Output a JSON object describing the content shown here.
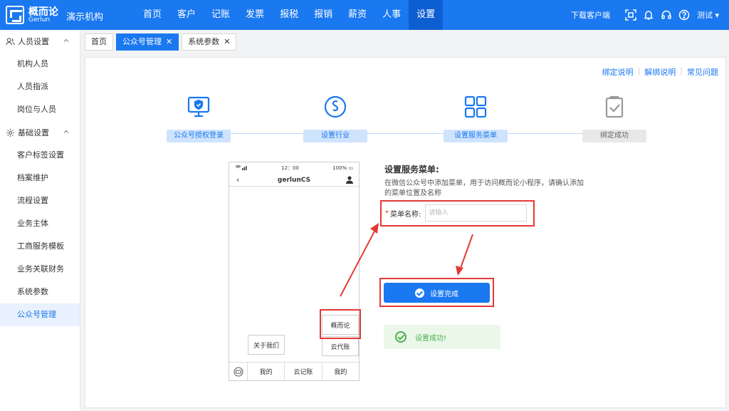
{
  "brand": {
    "name_cn": "概而论",
    "name_en": "Gerlun",
    "org": "演示机构"
  },
  "nav": [
    {
      "label": "首页",
      "active": false
    },
    {
      "label": "客户",
      "active": false
    },
    {
      "label": "记账",
      "active": false
    },
    {
      "label": "发票",
      "active": false
    },
    {
      "label": "报税",
      "active": false
    },
    {
      "label": "报销",
      "active": false
    },
    {
      "label": "薪资",
      "active": false
    },
    {
      "label": "人事",
      "active": false
    },
    {
      "label": "设置",
      "active": true
    }
  ],
  "topright": {
    "download": "下载客户端",
    "user": "测试 ▾"
  },
  "sidebar": {
    "group1": {
      "label": "人员设置",
      "items": [
        "机构人员",
        "人员指派",
        "岗位与人员"
      ]
    },
    "group2": {
      "label": "基础设置",
      "items": [
        "客户标签设置",
        "档案维护",
        "流程设置",
        "业务主体",
        "工商服务模板",
        "业务关联财务",
        "系统参数",
        "公众号管理"
      ]
    },
    "active_item": "公众号管理"
  },
  "tabs": [
    {
      "label": "首页",
      "closable": false,
      "active": false
    },
    {
      "label": "公众号管理",
      "closable": true,
      "active": true
    },
    {
      "label": "系统参数",
      "closable": true,
      "active": false
    }
  ],
  "help_links": [
    "绑定说明",
    "解绑说明",
    "常见问题"
  ],
  "steps": [
    {
      "label": "公众号授权登录",
      "icon": "monitor-shield-icon"
    },
    {
      "label": "设置行业",
      "icon": "s-circle-icon"
    },
    {
      "label": "设置服务菜单",
      "icon": "grid-icon"
    },
    {
      "label": "绑定成功",
      "icon": "clipboard-check-icon"
    }
  ],
  "phone": {
    "time": "12：00",
    "battery": "100%",
    "title": "gerlunCS",
    "submenu_top": "概而论",
    "submenu_bottom_left": "关于我们",
    "submenu_bottom_right": "云代账",
    "bottom_menus": [
      "我的",
      "云记账",
      "我的"
    ]
  },
  "form": {
    "title": "设置服务菜单:",
    "desc": "在微信公众号中添加菜单，用于访问概而论小程序，请确认添加的菜单位置及名称",
    "field_label": "菜单名称:",
    "required_mark": "*",
    "placeholder": "请输入",
    "value": "",
    "done_button": "设置完成",
    "success_text": "设置成功!"
  },
  "colors": {
    "primary": "#1a78f0",
    "highlight": "#e53935",
    "success": "#4caf50"
  }
}
